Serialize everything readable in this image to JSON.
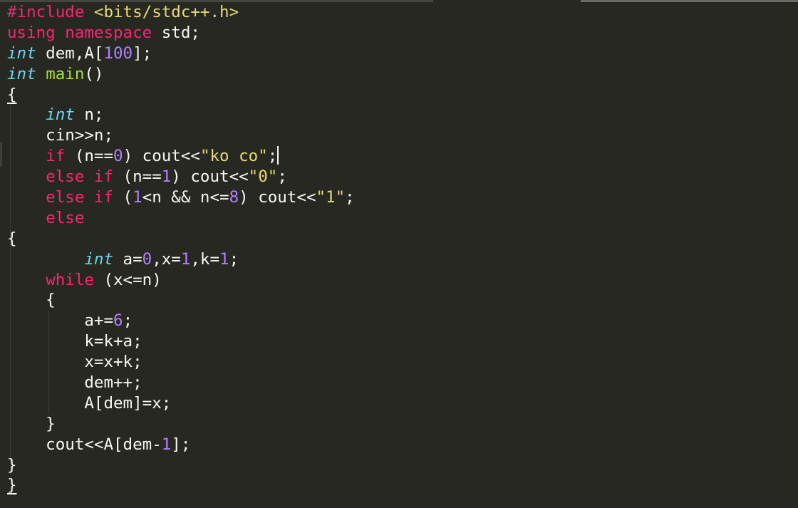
{
  "editor": {
    "theme": "monokai",
    "colors": {
      "background": "#272822",
      "keyword": "#F92672",
      "type": "#66D9EF",
      "function": "#A6E22E",
      "string": "#E6DB74",
      "number": "#AE81FF",
      "text": "#F8F8F2"
    },
    "cursor_line": 8,
    "lines": [
      [
        {
          "t": "#include ",
          "c": "pp"
        },
        {
          "t": "<bits/stdc++.h>",
          "c": "str"
        }
      ],
      [
        {
          "t": "using ",
          "c": "kw"
        },
        {
          "t": "namespace ",
          "c": "kw"
        },
        {
          "t": "std;",
          "c": ""
        }
      ],
      [
        {
          "t": "int",
          "c": "ty"
        },
        {
          "t": " dem,A[",
          "c": ""
        },
        {
          "t": "100",
          "c": "num"
        },
        {
          "t": "];",
          "c": ""
        }
      ],
      [
        {
          "t": "int",
          "c": "ty"
        },
        {
          "t": " ",
          "c": ""
        },
        {
          "t": "main",
          "c": "fn"
        },
        {
          "t": "()",
          "c": ""
        }
      ],
      [
        {
          "t": "{",
          "c": "ul"
        }
      ],
      [
        {
          "t": "    ",
          "c": ""
        },
        {
          "t": "int",
          "c": "ty"
        },
        {
          "t": " n;",
          "c": ""
        }
      ],
      [
        {
          "t": "    cin>>n;",
          "c": ""
        }
      ],
      [
        {
          "t": "    ",
          "c": ""
        },
        {
          "t": "if",
          "c": "kw"
        },
        {
          "t": " (n==",
          "c": ""
        },
        {
          "t": "0",
          "c": "num"
        },
        {
          "t": ") cout<<",
          "c": ""
        },
        {
          "t": "\"ko co\"",
          "c": "str"
        },
        {
          "t": ";",
          "c": ""
        },
        {
          "t": "",
          "c": "cursor"
        }
      ],
      [
        {
          "t": "    ",
          "c": ""
        },
        {
          "t": "else",
          "c": "kw"
        },
        {
          "t": " ",
          "c": ""
        },
        {
          "t": "if",
          "c": "kw"
        },
        {
          "t": " (n==",
          "c": ""
        },
        {
          "t": "1",
          "c": "num"
        },
        {
          "t": ") cout<<",
          "c": ""
        },
        {
          "t": "\"0\"",
          "c": "str"
        },
        {
          "t": ";",
          "c": ""
        }
      ],
      [
        {
          "t": "    ",
          "c": ""
        },
        {
          "t": "else",
          "c": "kw"
        },
        {
          "t": " ",
          "c": ""
        },
        {
          "t": "if",
          "c": "kw"
        },
        {
          "t": " (",
          "c": ""
        },
        {
          "t": "1",
          "c": "num"
        },
        {
          "t": "<n && n<=",
          "c": ""
        },
        {
          "t": "8",
          "c": "num"
        },
        {
          "t": ") cout<<",
          "c": ""
        },
        {
          "t": "\"1\"",
          "c": "str"
        },
        {
          "t": ";",
          "c": ""
        }
      ],
      [
        {
          "t": "    ",
          "c": ""
        },
        {
          "t": "else",
          "c": "kw"
        }
      ],
      [
        {
          "t": "{",
          "c": ""
        }
      ],
      [
        {
          "t": "        ",
          "c": ""
        },
        {
          "t": "int",
          "c": "ty"
        },
        {
          "t": " a=",
          "c": ""
        },
        {
          "t": "0",
          "c": "num"
        },
        {
          "t": ",x=",
          "c": ""
        },
        {
          "t": "1",
          "c": "num"
        },
        {
          "t": ",k=",
          "c": ""
        },
        {
          "t": "1",
          "c": "num"
        },
        {
          "t": ";",
          "c": ""
        }
      ],
      [
        {
          "t": "    ",
          "c": ""
        },
        {
          "t": "while",
          "c": "kw"
        },
        {
          "t": " (x<=n)",
          "c": ""
        }
      ],
      [
        {
          "t": "    {",
          "c": ""
        }
      ],
      [
        {
          "t": "        a+=",
          "c": ""
        },
        {
          "t": "6",
          "c": "num"
        },
        {
          "t": ";",
          "c": ""
        }
      ],
      [
        {
          "t": "        k=k+a;",
          "c": ""
        }
      ],
      [
        {
          "t": "        x=x+k;",
          "c": ""
        }
      ],
      [
        {
          "t": "        dem++;",
          "c": ""
        }
      ],
      [
        {
          "t": "        A[dem]=x;",
          "c": ""
        }
      ],
      [
        {
          "t": "    }",
          "c": ""
        }
      ],
      [
        {
          "t": "    cout<<A[dem-",
          "c": ""
        },
        {
          "t": "1",
          "c": "num"
        },
        {
          "t": "];",
          "c": ""
        }
      ],
      [
        {
          "t": "}",
          "c": ""
        }
      ],
      [
        {
          "t": "}",
          "c": "ul"
        }
      ]
    ]
  }
}
